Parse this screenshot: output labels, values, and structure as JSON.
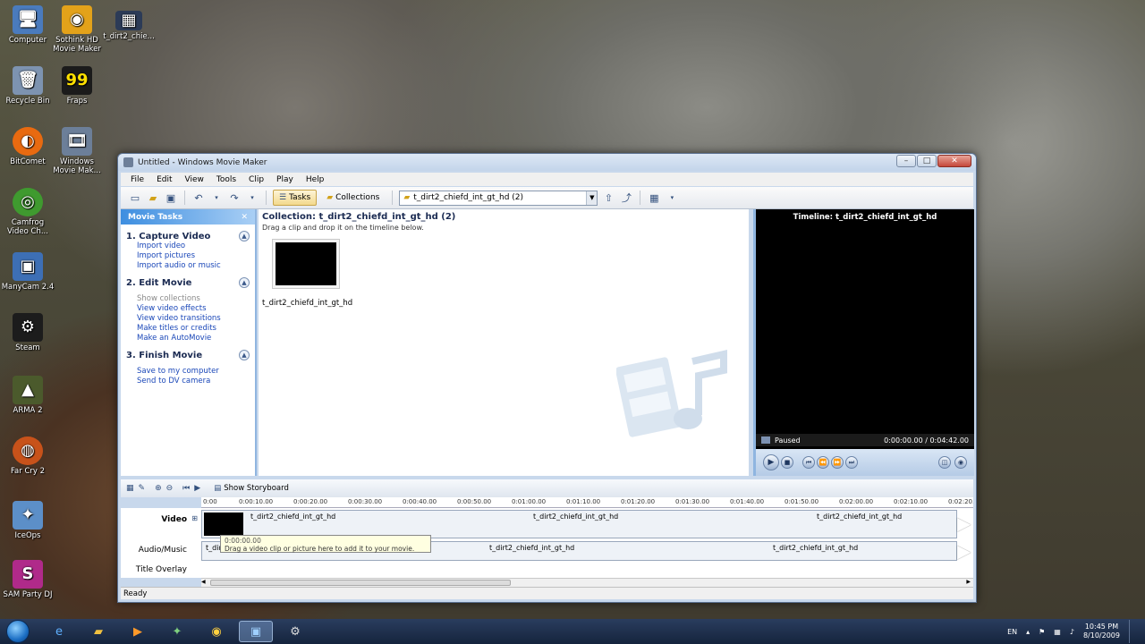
{
  "desktop": {
    "icons": [
      {
        "label": "Computer",
        "symbol": "🖥"
      },
      {
        "label": "Sothink HD Movie Maker",
        "symbol": "◉"
      },
      {
        "label": "t_dirt2_chie...",
        "symbol": "▦"
      },
      {
        "label": "Recycle Bin",
        "symbol": "🗑"
      },
      {
        "label": "Fraps",
        "symbol": "99"
      },
      {
        "label": "BitComet",
        "symbol": "◐"
      },
      {
        "label": "Windows Movie Mak...",
        "symbol": "🎞"
      },
      {
        "label": "Camfrog Video Ch...",
        "symbol": "◎"
      },
      {
        "label": "ManyCam 2.4",
        "symbol": "▣"
      },
      {
        "label": "Steam",
        "symbol": "⚙"
      },
      {
        "label": "ARMA 2",
        "symbol": "▲"
      },
      {
        "label": "Far Cry 2",
        "symbol": "◍"
      },
      {
        "label": "IceOps",
        "symbol": "✦"
      },
      {
        "label": "SAM Party DJ",
        "symbol": "S"
      }
    ]
  },
  "window": {
    "title": "Untitled - Windows Movie Maker",
    "buttons": {
      "minimize": "–",
      "maximize": "□",
      "close": "✕"
    }
  },
  "menu": [
    "File",
    "Edit",
    "View",
    "Tools",
    "Clip",
    "Play",
    "Help"
  ],
  "toolbar": {
    "tasks_label": "Tasks",
    "collections_label": "Collections",
    "collection_select": "t_dirt2_chiefd_int_gt_hd (2)"
  },
  "tasks_pane": {
    "header": "Movie Tasks",
    "close": "✕",
    "groups": [
      {
        "title": "1. Capture Video",
        "links": [
          "Import video",
          "Import pictures",
          "Import audio or music"
        ]
      },
      {
        "title": "2. Edit Movie",
        "links": [
          "Show collections",
          "View video effects",
          "View video transitions",
          "Make titles or credits",
          "Make an AutoMovie"
        ]
      },
      {
        "title": "3. Finish Movie",
        "links": [
          "Save to my computer",
          "Send to DV camera"
        ]
      }
    ]
  },
  "collection": {
    "title": "Collection: t_dirt2_chiefd_int_gt_hd (2)",
    "subtitle": "Drag a clip and drop it on the timeline below.",
    "clip_name": "t_dirt2_chiefd_int_gt_hd"
  },
  "preview": {
    "title": "Timeline: t_dirt2_chiefd_int_gt_hd",
    "state": "Paused",
    "time": "0:00:00.00 / 0:04:42.00"
  },
  "timeline": {
    "show_storyboard": "Show Storyboard",
    "ruler": [
      "0:00",
      "0:00:10.00",
      "0:00:20.00",
      "0:00:30.00",
      "0:00:40.00",
      "0:00:50.00",
      "0:01:00.00",
      "0:01:10.00",
      "0:01:20.00",
      "0:01:30.00",
      "0:01:40.00",
      "0:01:50.00",
      "0:02:00.00",
      "0:02:10.00",
      "0:02:20.00"
    ],
    "tracks": {
      "video": "Video",
      "audio": "Audio/Music",
      "title_overlay": "Title Overlay"
    },
    "clip_name": "t_dirt2_chiefd_int_gt_hd",
    "audio_clip_short": "t_dir",
    "tooltip_time": "0:00:00.00",
    "tooltip_text": "Drag a video clip or picture here to add it to your movie."
  },
  "status": "Ready",
  "taskbar": {
    "lang": "EN",
    "time": "10:45 PM",
    "date": "8/10/2009"
  },
  "colors": {
    "accent": "#3d8ee0",
    "link": "#1a47b8",
    "title": "#1b2b52"
  }
}
